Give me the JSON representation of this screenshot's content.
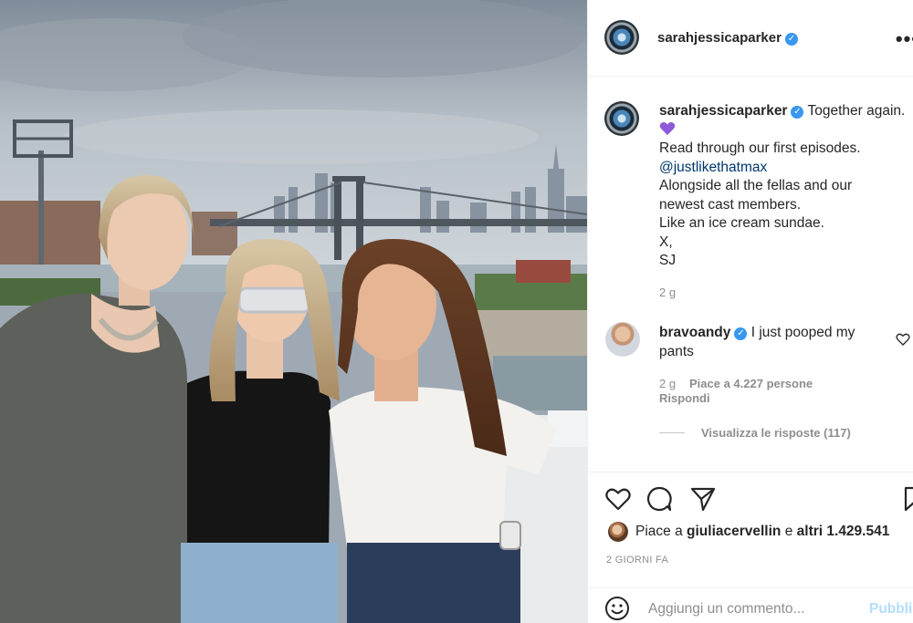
{
  "post": {
    "author": "sarahjessicaparker",
    "photo_alt": "Three women posing on a rooftop with the New York City skyline behind them"
  },
  "header": {
    "username": "sarahjessicaparker",
    "more": "•••"
  },
  "caption": {
    "username": "sarahjessicaparker",
    "first_line": "Together again.",
    "lines": [
      "Read through our first episodes.",
      "@justlikethatmax",
      "Alongside all the fellas and our",
      "newest cast members.",
      "Like an ice cream sundae.",
      "X,",
      "SJ"
    ],
    "time": "2 g"
  },
  "comment": {
    "username": "bravoandy",
    "text_part1": "I just pooped my",
    "text_part2": "pants",
    "time": "2 g",
    "likes": "Piace a 4.227 persone",
    "reply": "Rispondi",
    "view_replies": "Visualizza le risposte (117)"
  },
  "actions": {
    "likes_prefix": "Piace a",
    "likes_user": "giuliacervellin",
    "likes_middle": "e",
    "likes_count": "altri 1.429.541",
    "date": "2 GIORNI FA"
  },
  "add_comment": {
    "placeholder": "Aggiungi un commento...",
    "publish": "Pubblica"
  },
  "colors": {
    "link": "#00376b",
    "verified": "#3897f0",
    "publish": "#b2dffc",
    "muted": "#8e8e8e"
  }
}
